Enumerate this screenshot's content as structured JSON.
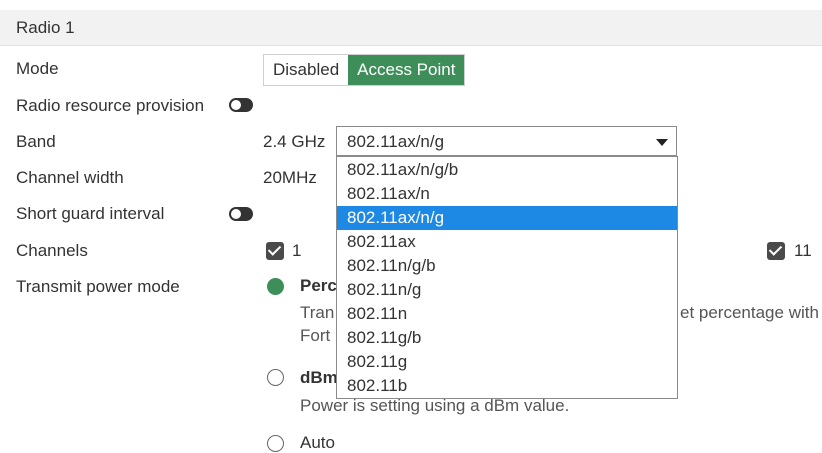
{
  "section": {
    "title": "Radio 1"
  },
  "labels": {
    "mode": "Mode",
    "rrp": "Radio resource provision",
    "band": "Band",
    "channel_width": "Channel width",
    "sgi": "Short guard interval",
    "channels": "Channels",
    "tx_power_mode": "Transmit power mode"
  },
  "mode": {
    "options": [
      "Disabled",
      "Access Point"
    ],
    "selected": "Access Point"
  },
  "band": {
    "freq": "2.4 GHz",
    "value": "802.11ax/n/g",
    "options": [
      "802.11ax/n/g/b",
      "802.11ax/n",
      "802.11ax/n/g",
      "802.11ax",
      "802.11n/g/b",
      "802.11n/g",
      "802.11n",
      "802.11g/b",
      "802.11g",
      "802.11b"
    ]
  },
  "channel_width": {
    "value": "20MHz"
  },
  "channels": {
    "first": "1",
    "last": "11"
  },
  "tx_power": {
    "opt1_name": "Perc",
    "opt1_desc_left_1": "Tran",
    "opt1_desc_left_2": "Fort",
    "opt1_desc_right": "et percentage with",
    "opt2_name": "dBm",
    "opt2_desc": "Power is setting using a dBm value.",
    "opt3_name": "Auto"
  },
  "colors": {
    "accent": "#3e8e5a",
    "selection": "#1e88e5"
  }
}
